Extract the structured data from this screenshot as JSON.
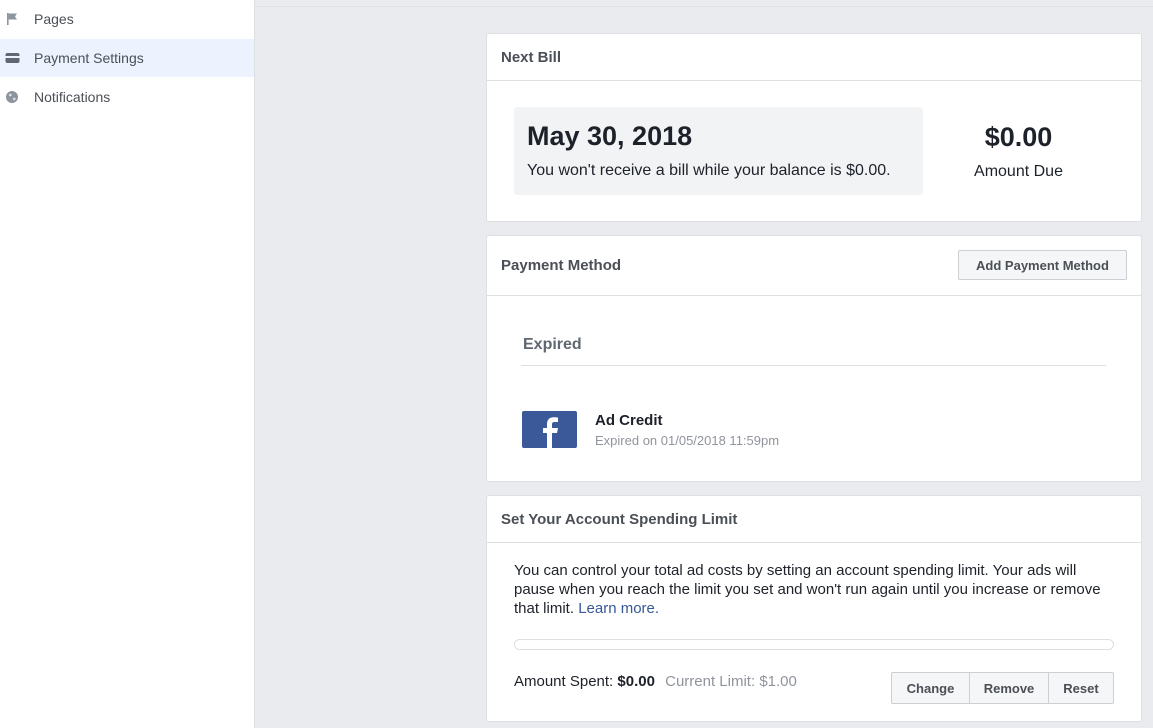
{
  "sidebar": {
    "items": [
      {
        "label": "Pages",
        "icon": "flag-icon",
        "active": false
      },
      {
        "label": "Payment Settings",
        "icon": "credit-card-icon",
        "active": true
      },
      {
        "label": "Notifications",
        "icon": "globe-icon",
        "active": false
      }
    ]
  },
  "next_bill": {
    "title": "Next Bill",
    "date": "May 30, 2018",
    "note": "You won't receive a bill while your balance is $0.00.",
    "amount": "$0.00",
    "amount_label": "Amount Due"
  },
  "payment_method": {
    "title": "Payment Method",
    "add_button": "Add Payment Method",
    "section_label": "Expired",
    "item_title": "Ad Credit",
    "item_subtitle": "Expired on 01/05/2018 11:59pm",
    "item_icon": "facebook-logo-icon"
  },
  "spending_limit": {
    "title": "Set Your Account Spending Limit",
    "description": "You can control your total ad costs by setting an account spending limit. Your ads will pause when you reach the limit you set and won't run again until you increase or remove that limit.",
    "learn_more": "Learn more.",
    "progress_fraction": 0,
    "amount_spent_label": "Amount Spent:",
    "amount_spent_value": "$0.00",
    "current_limit": "Current Limit: $1.00",
    "buttons": {
      "change": "Change",
      "remove": "Remove",
      "reset": "Reset"
    }
  },
  "colors": {
    "background": "#e9ebee",
    "active_nav": "#ecf3ff",
    "facebook_blue": "#3b5998",
    "link": "#365899"
  }
}
